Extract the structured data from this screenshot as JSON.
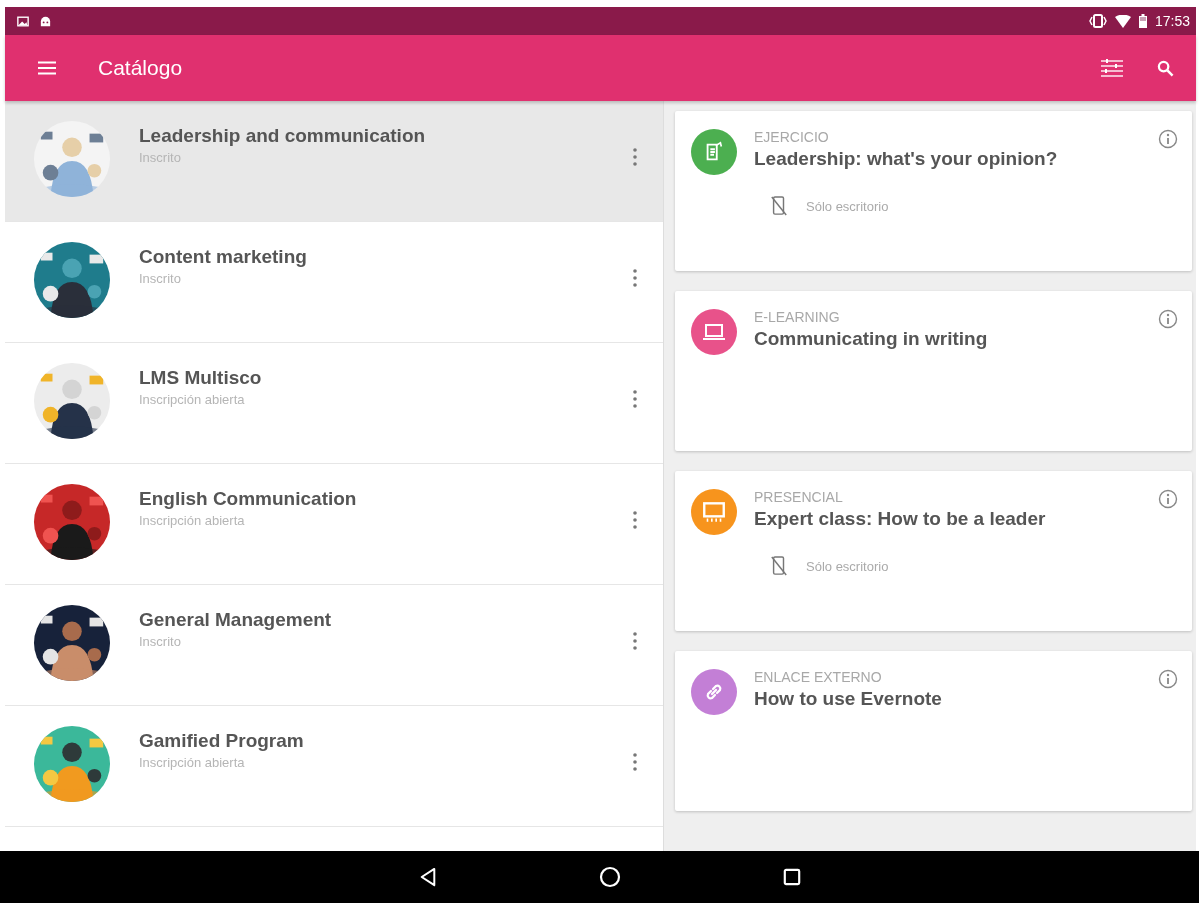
{
  "status_bar": {
    "time": "17:53"
  },
  "toolbar": {
    "title": "Catálogo"
  },
  "courses": [
    {
      "title": "Leadership and communication",
      "status": "Inscrito",
      "selected": true
    },
    {
      "title": "Content marketing",
      "status": "Inscrito",
      "selected": false
    },
    {
      "title": "LMS Multisco",
      "status": "Inscripción abierta",
      "selected": false
    },
    {
      "title": "English Communication",
      "status": "Inscripción abierta",
      "selected": false
    },
    {
      "title": "General Management",
      "status": "Inscrito",
      "selected": false
    },
    {
      "title": "Gamified Program",
      "status": "Inscripción abierta",
      "selected": false
    }
  ],
  "activities": [
    {
      "kind": "exercise",
      "type_label": "EJERCICIO",
      "title": "Leadership: what's your opinion?",
      "color": "#4caf50",
      "note": "Sólo escritorio"
    },
    {
      "kind": "elearning",
      "type_label": "E-LEARNING",
      "title": "Communicating in writing",
      "color": "#e8528a"
    },
    {
      "kind": "classroom",
      "type_label": "PRESENCIAL",
      "title": "Expert class: How to be a leader",
      "color": "#f7941d",
      "note": "Sólo escritorio"
    },
    {
      "kind": "link",
      "type_label": "ENLACE EXTERNO",
      "title": "How to use Evernote",
      "color": "#c37fd6"
    }
  ]
}
